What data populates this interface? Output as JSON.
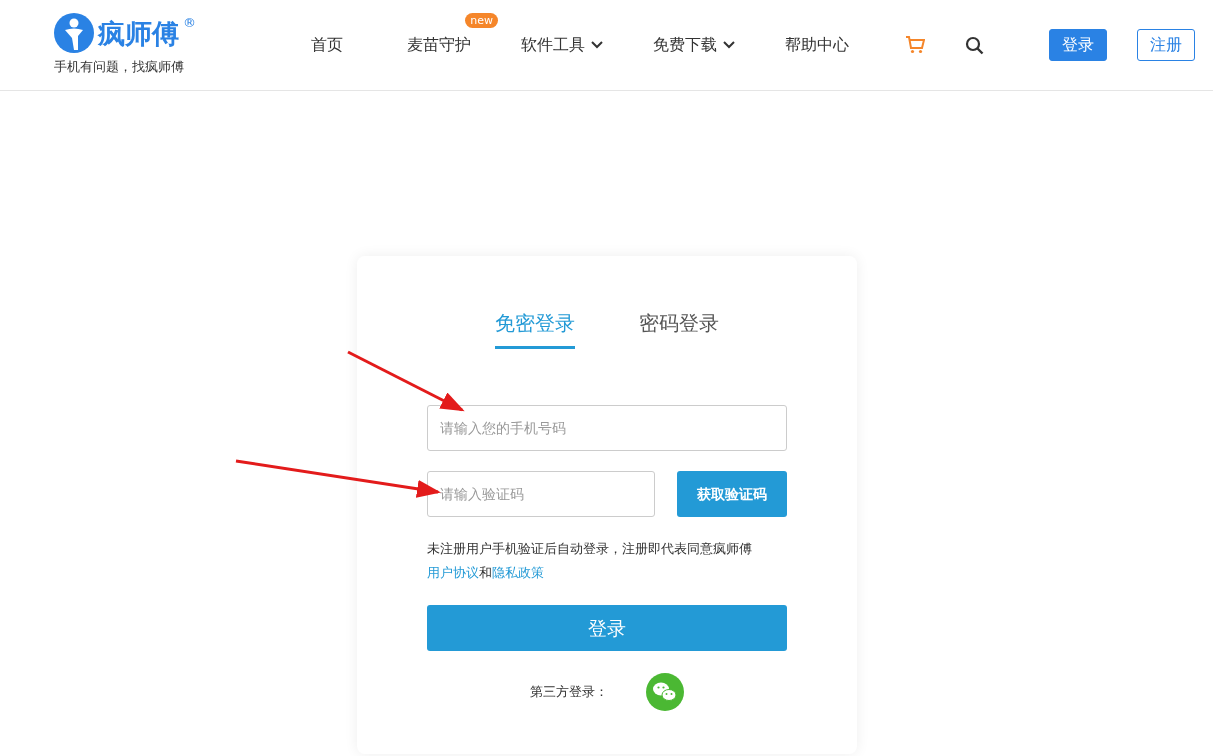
{
  "header": {
    "logo": {
      "name": "疯师傅",
      "mark": "®",
      "slogan": "手机有问题，找疯师傅"
    },
    "nav": [
      {
        "label": "首页",
        "dropdown": false
      },
      {
        "label": "麦苗守护",
        "badge": "new",
        "dropdown": false
      },
      {
        "label": "软件工具",
        "dropdown": true
      },
      {
        "label": "免费下载",
        "dropdown": true
      },
      {
        "label": "帮助中心",
        "dropdown": false
      }
    ],
    "buttons": [
      {
        "label": "登录",
        "kind": "primary"
      },
      {
        "label": "注册",
        "kind": "outline"
      }
    ]
  },
  "login": {
    "tabs": [
      {
        "label": "免密登录",
        "selected": true
      },
      {
        "label": "密码登录",
        "selected": false
      }
    ],
    "phone": {
      "placeholder": "请输入您的手机号码"
    },
    "code": {
      "placeholder": "请输入验证码"
    },
    "get_code_button": "获取验证码",
    "agreement": {
      "text": "未注册用户手机验证后自动登录，注册即代表同意疯师傅",
      "links": [
        "用户协议",
        "隐私政策"
      ],
      "joiner": "和"
    },
    "submit": "登录",
    "third_party_label": "第三方登录："
  }
}
